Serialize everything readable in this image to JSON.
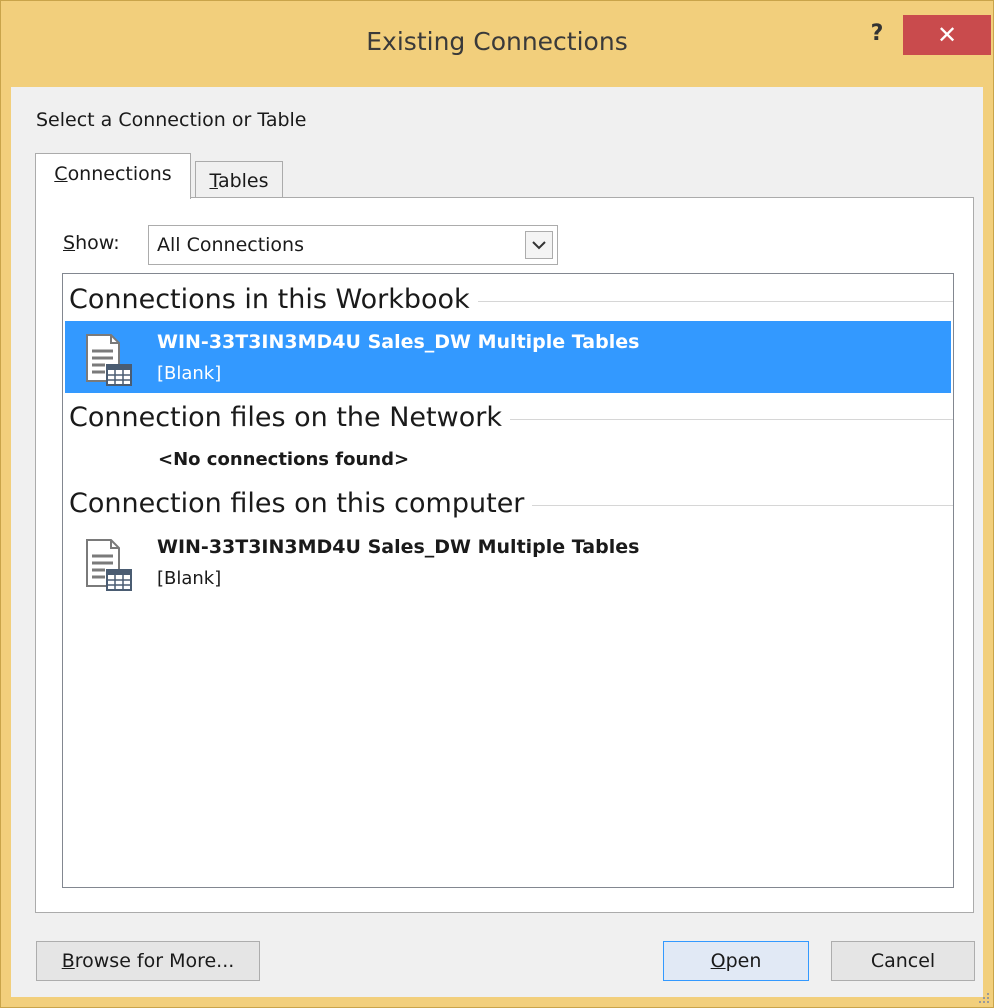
{
  "window": {
    "title": "Existing Connections",
    "help": "?",
    "close": "✕"
  },
  "labels": {
    "select": "Select a Connection or Table"
  },
  "tabs": [
    {
      "pre": "",
      "acc": "C",
      "post": "onnections"
    },
    {
      "pre": "",
      "acc": "T",
      "post": "ables"
    }
  ],
  "show": {
    "pre": "",
    "acc": "S",
    "post": "how:",
    "value": "All Connections"
  },
  "groups": [
    {
      "header": "Connections in this Workbook",
      "items": [
        {
          "name": "WIN-33T3IN3MD4U Sales_DW Multiple Tables",
          "desc": "[Blank]"
        }
      ]
    },
    {
      "header": "Connection files on the Network",
      "empty": "<No connections found>"
    },
    {
      "header": "Connection files on this computer",
      "items": [
        {
          "name": "WIN-33T3IN3MD4U Sales_DW Multiple Tables",
          "desc": "[Blank]"
        }
      ]
    }
  ],
  "buttons": {
    "browse": {
      "pre": "",
      "acc": "B",
      "post": "rowse for More..."
    },
    "open": {
      "pre": "",
      "acc": "O",
      "post": "pen"
    },
    "cancel": "Cancel"
  },
  "colors": {
    "frame": "#f2cf7c",
    "close": "#c94b4d",
    "selection": "#3399ff"
  }
}
